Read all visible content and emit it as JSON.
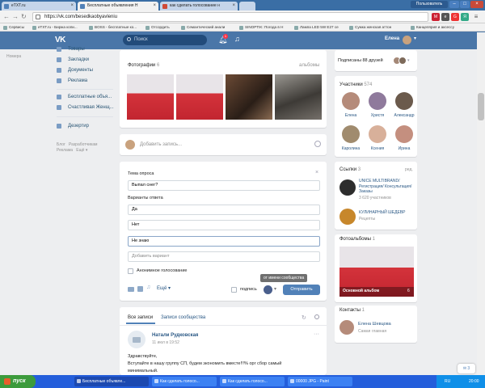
{
  "browser": {
    "tabs": [
      {
        "title": "eTXT.ru"
      },
      {
        "title": "Бесплатные объявления Н"
      },
      {
        "title": "как сделать голосование н"
      }
    ],
    "url": "https://vk.com/besedkaobyavleniu",
    "window_user": "Пользователь",
    "bookmarks": [
      "Сервисы",
      "eTXT.ru - Биржа копи...",
      "BOSS - бесплатные ко...",
      "Отсордить",
      "Семантический анали",
      "SINOPTIK: Погода в Н",
      "Лампа LED 5W E27 сe",
      "Сумка женская аттон",
      "Канцелярия и аксессу"
    ]
  },
  "vk_header": {
    "logo": "VK",
    "search_placeholder": "Поиск",
    "notif_count": "1",
    "user_name": "Елена"
  },
  "left_menu": {
    "cut_label": "Номера",
    "items": [
      {
        "label": "Товары",
        "icon": "market-icon"
      },
      {
        "label": "Закладки",
        "icon": "bookmark-icon"
      },
      {
        "label": "Документы",
        "icon": "document-icon"
      },
      {
        "label": "Реклама",
        "icon": "ads-icon"
      },
      {
        "label": "Бесплатные объя...",
        "icon": "group-icon"
      },
      {
        "label": "Счастливая Женщ...",
        "icon": "group-icon"
      },
      {
        "label": "Дезертир",
        "icon": "game-icon"
      }
    ],
    "footer": [
      "Блог",
      "Разработчикам",
      "Реклама",
      "Ещё"
    ]
  },
  "photos": {
    "title": "Фотографии",
    "count": "6",
    "albums_link": "альбомы"
  },
  "composer": {
    "placeholder": "Добавить запись..."
  },
  "poll": {
    "topic_label": "Тема опроса",
    "topic_value": "Выпал снег?",
    "options_label": "Варианты ответа",
    "options": [
      "Да",
      "Нет",
      "Не знаю"
    ],
    "add_option_placeholder": "Добавить вариант",
    "anonymous_label": "Анонимное голосование",
    "more_label": "Ещё",
    "signature_label": "подпись",
    "tooltip": "от имени сообщества",
    "submit_label": "Отправить"
  },
  "wall": {
    "tabs": [
      "Все записи",
      "Записи сообщества"
    ],
    "post": {
      "author": "Натали Рудковская",
      "time": "11 июл в 19:52",
      "text_lines": [
        "Здравствуйте,",
        "Вступайте в нашу группу СП, будем экономить вместе!!!% орг сбор самый",
        "минимальный."
      ]
    }
  },
  "right": {
    "subscribed_text": "Подписаны 88 друзей",
    "members_title": "Участники",
    "members_count": "574",
    "members": [
      {
        "name": "Елена",
        "color": "#b58b7a"
      },
      {
        "name": "Христя",
        "color": "#8f7a9c"
      },
      {
        "name": "Александр",
        "color": "#6b5a4c"
      },
      {
        "name": "Каролина",
        "color": "#a08b6e"
      },
      {
        "name": "Ксения",
        "color": "#d8b09a"
      },
      {
        "name": "Ирина",
        "color": "#c48f7f"
      }
    ],
    "links_title": "Ссылки",
    "links_count": "3",
    "links_edit": "ред.",
    "links": [
      {
        "title": "UNICE MULTIBRAND/ Регистрация/ Консультация/Заказы",
        "sub": "3 620 участников"
      },
      {
        "title": "КУЛИНАРНЫЙ ШЕДЕВР",
        "sub": "Рецепты"
      }
    ],
    "albums_title": "Фотоальбомы",
    "albums_count": "1",
    "album_name": "Основной альбом",
    "album_count": "6",
    "contacts_title": "Контакты",
    "contacts_count": "1",
    "contact_name": "Елена Шевцова",
    "contact_role": "Самая главная"
  },
  "chat": {
    "count": "3"
  },
  "taskbar": {
    "start": "пуск",
    "items": [
      "Бесплатные объявле...",
      "Как сделать голосо...",
      "Как сделать голосо...",
      "00000 JPG - Paint"
    ],
    "lang": "RU",
    "time": "20:00"
  }
}
